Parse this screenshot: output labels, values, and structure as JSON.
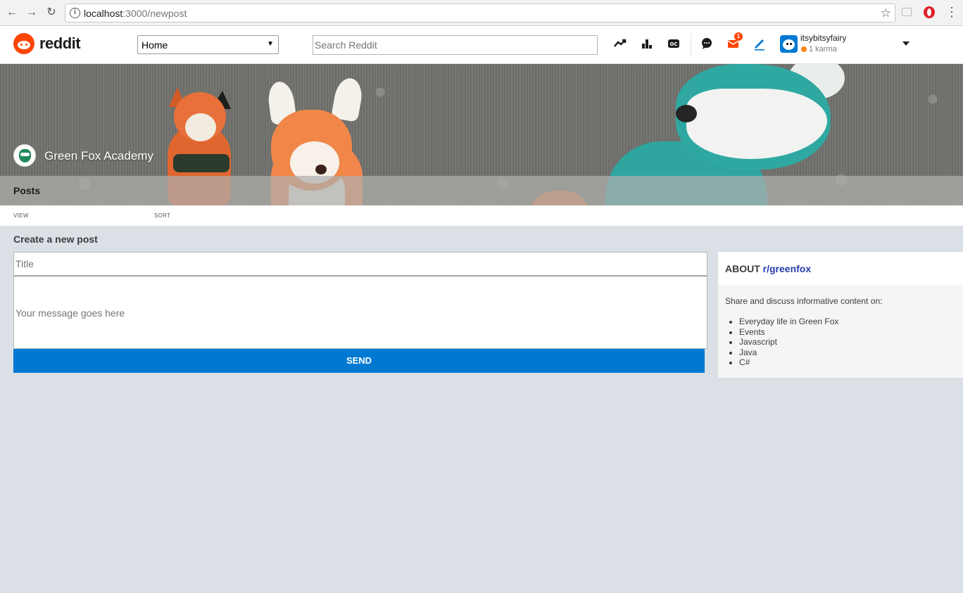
{
  "browser": {
    "url_host": "localhost",
    "url_path": ":3000/newpost"
  },
  "header": {
    "logo_text": "reddit",
    "feed_select": "Home",
    "search_placeholder": "Search Reddit",
    "notification_count": "1",
    "username": "itsybitsyfairy",
    "karma": "1 karma"
  },
  "banner": {
    "community_name": "Green Fox Academy",
    "tab": "Posts"
  },
  "subbar": {
    "view_label": "VIEW",
    "sort_label": "SORT"
  },
  "form": {
    "heading": "Create a new post",
    "title_placeholder": "Title",
    "message_placeholder": "Your message goes here",
    "send_label": "SEND"
  },
  "sidebar": {
    "about_label": "ABOUT",
    "subreddit": "r/greenfox",
    "description": "Share and discuss informative content on:",
    "topics": [
      "Everyday life in Green Fox",
      "Events",
      "Javascript",
      "Java",
      "C#"
    ]
  },
  "colors": {
    "accent": "#0079d3",
    "brand": "#ff4500",
    "background": "#dae0e6",
    "subreddit_link": "#273cae"
  }
}
